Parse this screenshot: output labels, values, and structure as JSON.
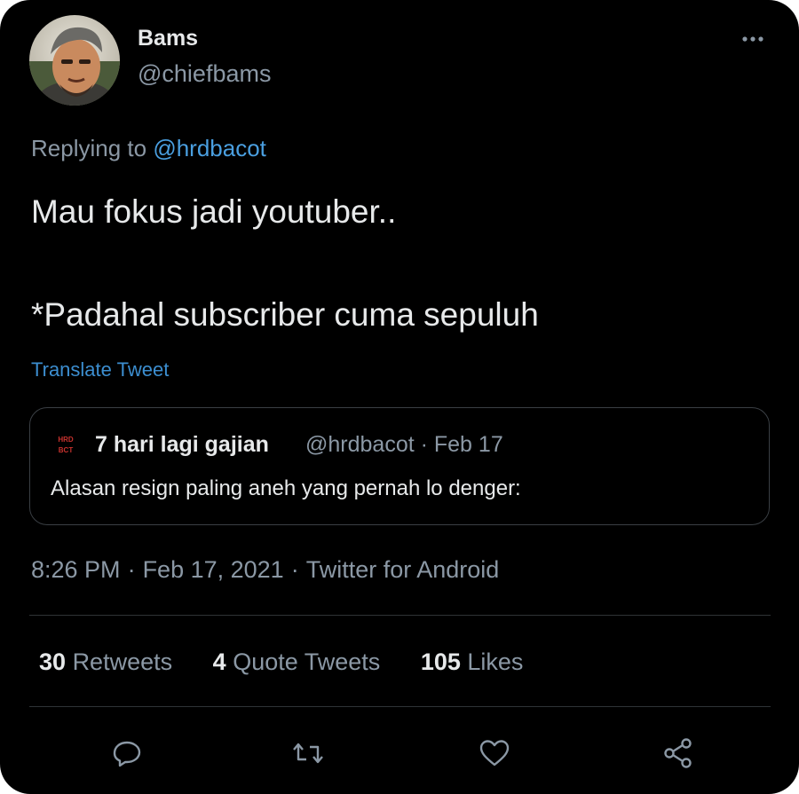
{
  "author": {
    "display_name": "Bams",
    "handle": "@chiefbams"
  },
  "replying": {
    "prefix": "Replying to",
    "mention": "@hrdbacot"
  },
  "tweet": {
    "lines": [
      "Mau fokus jadi youtuber..",
      "*Padahal subscriber cuma sepuluh"
    ]
  },
  "translate_label": "Translate Tweet",
  "quoted": {
    "logo_text": "HRD BCT",
    "name": "7 hari lagi gajian",
    "meta": "@hrdbacot · Feb 17",
    "text": "Alasan resign paling aneh yang pernah lo denger:"
  },
  "meta": {
    "time": "8:26 PM",
    "date": "Feb 17, 2021",
    "source": "Twitter for Android",
    "dot": "·"
  },
  "stats": [
    {
      "count": "30",
      "label": "Retweets"
    },
    {
      "count": "4",
      "label": "Quote Tweets"
    },
    {
      "count": "105",
      "label": "Likes"
    }
  ],
  "actions": [
    {
      "icon": "reply-icon"
    },
    {
      "icon": "retweet-icon"
    },
    {
      "icon": "like-icon"
    },
    {
      "icon": "share-icon"
    }
  ],
  "colors": {
    "background": "#000000",
    "primary_text": "#e7e9ea",
    "secondary_text": "#8b98a5",
    "link": "#4a9fe0",
    "border": "#2f3336"
  }
}
